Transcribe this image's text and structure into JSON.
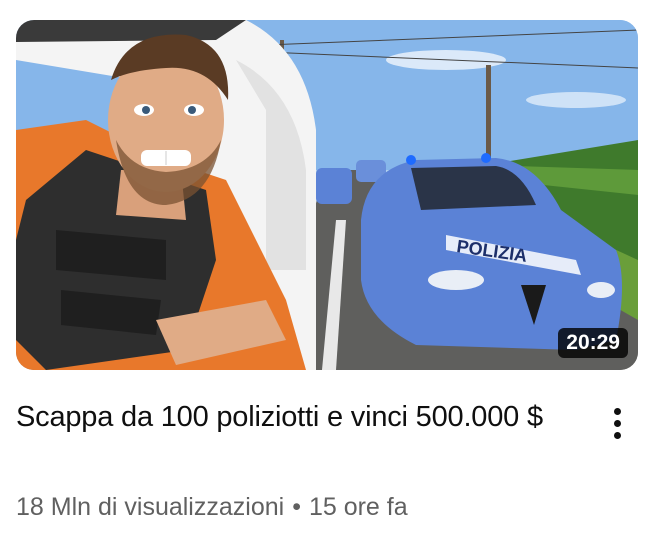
{
  "video": {
    "duration": "20:29",
    "title": "Scappa da 100 poliziotti e vinci 500.000 $",
    "views": "18 Mln di visualizzazioni",
    "separator": "•",
    "age": "15 ore fa",
    "thumbnail_text": "POLIZIA"
  },
  "icons": {
    "more": "more-vert-icon"
  },
  "colors": {
    "title": "#0f0f0f",
    "meta": "#606060",
    "police_car": "#5b82d6",
    "shirt": "#e8782b"
  }
}
